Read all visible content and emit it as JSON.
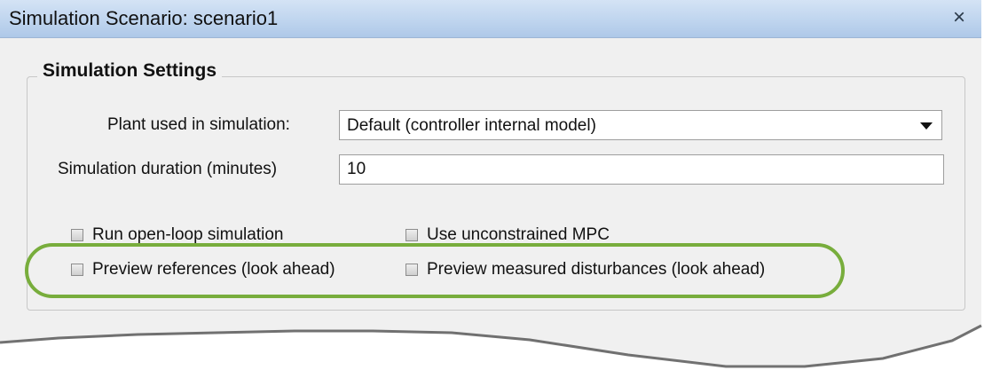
{
  "window": {
    "title": "Simulation Scenario: scenario1",
    "close_label": "×"
  },
  "settings": {
    "group_title": "Simulation Settings",
    "plant_label": "Plant used in simulation:",
    "plant_value": "Default (controller internal model)",
    "duration_label": "Simulation duration (minutes)",
    "duration_value": "10"
  },
  "options": {
    "open_loop": {
      "label": "Run open-loop simulation",
      "checked": false
    },
    "unconstrained": {
      "label": "Use unconstrained MPC",
      "checked": false
    },
    "preview_references": {
      "label": "Preview references (look ahead)",
      "checked": false
    },
    "preview_disturbances": {
      "label": "Preview measured disturbances (look ahead)",
      "checked": false
    }
  },
  "colors": {
    "highlight": "#78ad3c",
    "titlebar": "#c1d6ef",
    "background": "#f0f0f0"
  }
}
